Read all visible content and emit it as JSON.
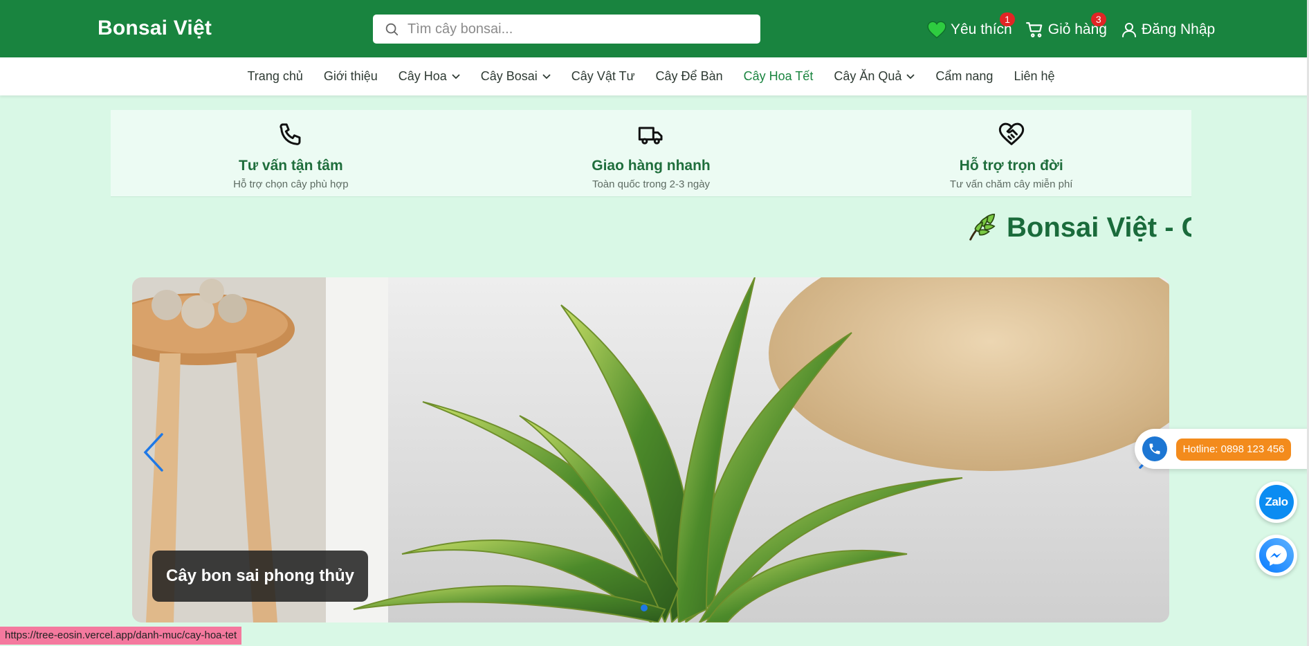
{
  "header": {
    "brand": "Bonsai Việt",
    "search_placeholder": "Tìm cây bonsai...",
    "wishlist_label": "Yêu thích",
    "wishlist_count": "1",
    "cart_label": "Giỏ hàng",
    "cart_count": "3",
    "login_label": "Đăng Nhập"
  },
  "nav": {
    "items": [
      {
        "label": "Trang chủ"
      },
      {
        "label": "Giới thiệu"
      },
      {
        "label": "Cây Hoa"
      },
      {
        "label": "Cây Bosai"
      },
      {
        "label": "Cây Vật Tư"
      },
      {
        "label": "Cây Để Bàn"
      },
      {
        "label": "Cây Hoa Tết"
      },
      {
        "label": "Cây Ăn Quả"
      },
      {
        "label": "Cẩm nang"
      },
      {
        "label": "Liên hệ"
      }
    ],
    "active": "Cây Hoa Tết"
  },
  "features": [
    {
      "title": "Tư vấn tận tâm",
      "subtitle": "Hỗ trợ chọn cây phù hợp",
      "icon": "phone-icon"
    },
    {
      "title": "Giao hàng nhanh",
      "subtitle": "Toàn quốc trong 2-3 ngày",
      "icon": "truck-icon"
    },
    {
      "title": "Hỗ trợ trọn đời",
      "subtitle": "Tư vấn chăm cây miễn phí",
      "icon": "heart-handshake-icon"
    }
  ],
  "marquee": {
    "text": "Bonsai Việt - Câ"
  },
  "slider": {
    "caption": "Cây bon sai phong thủy"
  },
  "widgets": {
    "hotline": "Hotline: 0898 123 456",
    "zalo": "Zalo"
  },
  "status_url": "https://tree-eosin.vercel.app/danh-muc/cay-hoa-tet",
  "colors": {
    "primary": "#19843f",
    "background": "#d9f8e6",
    "accent": "#f38b1c"
  }
}
